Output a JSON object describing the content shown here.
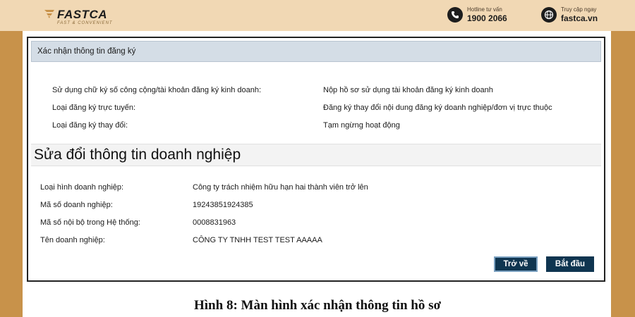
{
  "brand": {
    "name": "FASTCA",
    "tagline": "FAST & CONVENIENT"
  },
  "contacts": {
    "hotline_label": "Hotline tư vấn",
    "hotline_number": "1900 2066",
    "web_label": "Truy cập ngay",
    "web_domain": "fastca.vn"
  },
  "panel": {
    "title": "Xác nhận thông tin đăng ký",
    "fields": [
      {
        "label": "Sử dụng chữ ký số công cộng/tài khoản đăng ký kinh doanh:",
        "value": "Nộp hồ sơ sử dụng tài khoản đăng ký kinh doanh"
      },
      {
        "label": "Loại đăng ký trực tuyến:",
        "value": "Đăng ký thay đổi nội dung đăng ký doanh nghiệp/đơn vị trực thuộc"
      },
      {
        "label": "Loại đăng ký thay đổi:",
        "value": "Tạm ngừng hoạt động"
      }
    ]
  },
  "section": {
    "title": "Sửa đổi thông tin doanh nghiệp",
    "fields": [
      {
        "label": "Loại hình doanh nghiệp:",
        "value": "Công ty trách nhiệm hữu hạn hai thành viên trở lên"
      },
      {
        "label": "Mã số doanh nghiệp:",
        "value": "19243851924385"
      },
      {
        "label": "Mã số nội bộ trong Hệ thống:",
        "value": "0008831963"
      },
      {
        "label": "Tên doanh nghiệp:",
        "value": "CÔNG TY TNHH TEST TEST AAAAA"
      }
    ]
  },
  "buttons": {
    "back": "Trở về",
    "start": "Bắt đầu"
  },
  "caption": "Hình 8: Màn hình xác nhận thông tin hồ sơ",
  "colors": {
    "background": "#c8924a",
    "topbar": "#f1d8b4",
    "panel_header": "#d4dde6",
    "button": "#0f3550"
  }
}
